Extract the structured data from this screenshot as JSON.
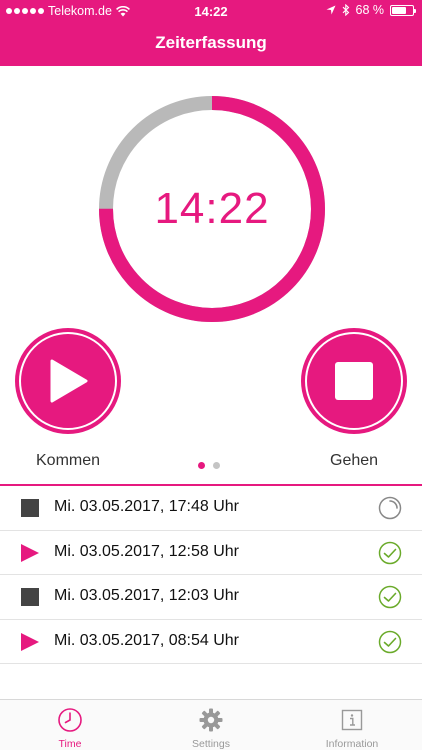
{
  "status_bar": {
    "carrier": "Telekom.de",
    "time": "14:22",
    "battery": "68 %",
    "battery_level": 0.68
  },
  "header": {
    "title": "Zeiterfassung"
  },
  "clock": {
    "time": "14:22",
    "progress_fraction": 0.75
  },
  "actions": {
    "kommen_label": "Kommen",
    "gehen_label": "Gehen"
  },
  "pager": {
    "pages": 2,
    "active": 0
  },
  "entries": [
    {
      "type": "stop",
      "text": "Mi. 03.05.2017, 17:48 Uhr",
      "status": "pending"
    },
    {
      "type": "start",
      "text": "Mi. 03.05.2017, 12:58 Uhr",
      "status": "done"
    },
    {
      "type": "stop",
      "text": "Mi. 03.05.2017, 12:03 Uhr",
      "status": "done"
    },
    {
      "type": "start",
      "text": "Mi. 03.05.2017, 08:54 Uhr",
      "status": "done"
    }
  ],
  "tabs": [
    {
      "label": "Time",
      "icon": "clock-icon",
      "active": true
    },
    {
      "label": "Settings",
      "icon": "gear-icon",
      "active": false
    },
    {
      "label": "Information",
      "icon": "info-icon",
      "active": false
    }
  ],
  "colors": {
    "accent": "#e6197f",
    "ring_track": "#b9b9b9",
    "check": "#6aaa2a",
    "icon_dark": "#444444",
    "tab_inactive": "#999999"
  }
}
